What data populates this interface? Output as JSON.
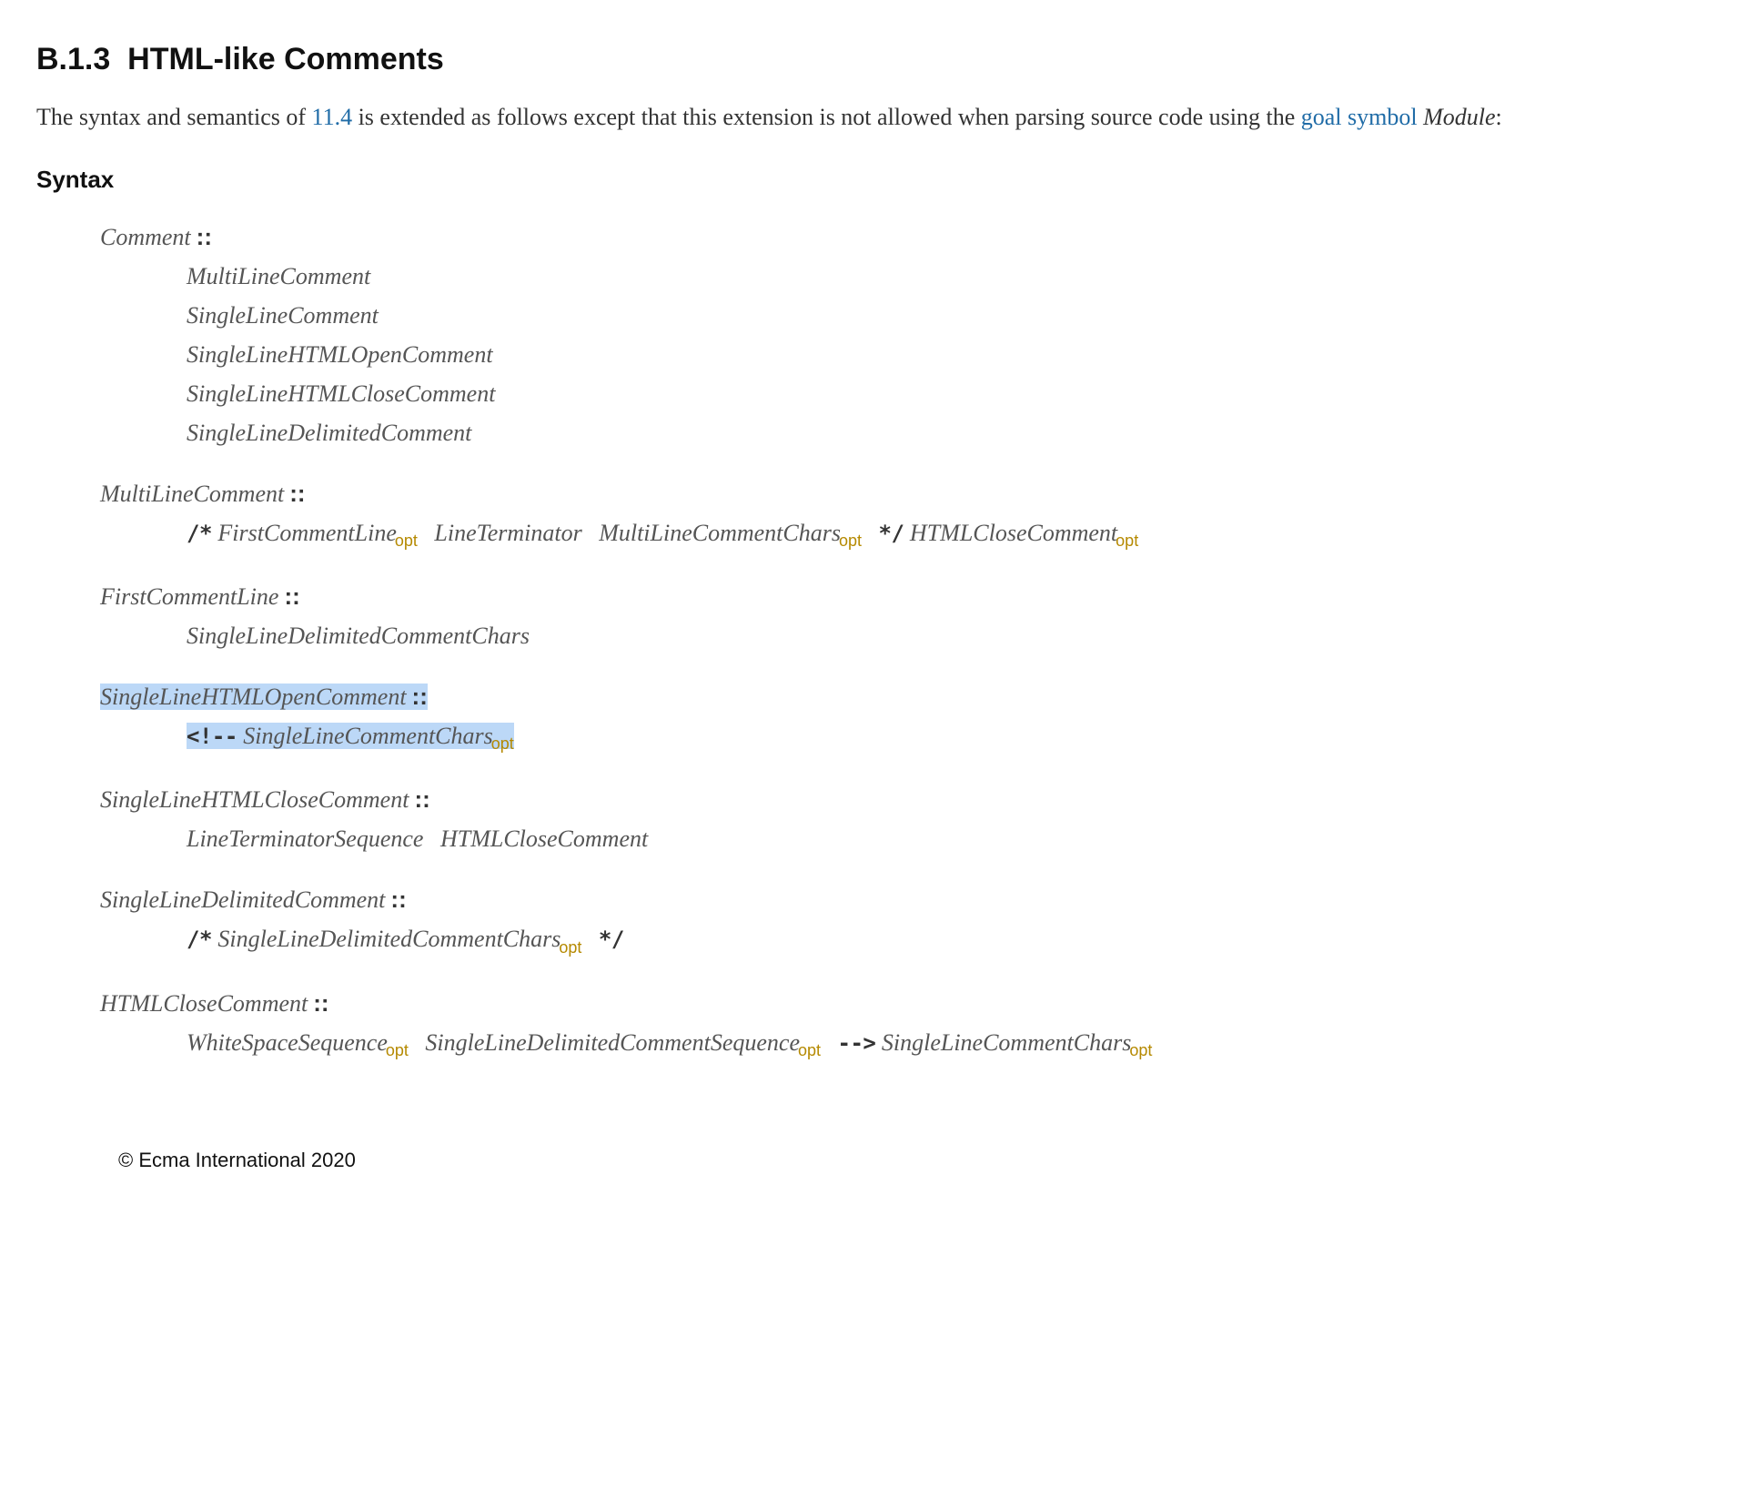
{
  "heading": {
    "number": "B.1.3",
    "title": "HTML-like Comments"
  },
  "intro": {
    "t1": "The syntax and semantics of ",
    "link1": "11.4",
    "t2": " is extended as follows except that this extension is not allowed when parsing source code using the ",
    "link2": "goal symbol",
    "t3": " ",
    "module": "Module",
    "t4": ":"
  },
  "syntaxLabel": "Syntax",
  "sep": "::",
  "opt": "opt",
  "p1": {
    "lhs": "Comment",
    "r1": "MultiLineComment",
    "r2": "SingleLineComment",
    "r3": "SingleLineHTMLOpenComment",
    "r4": "SingleLineHTMLCloseComment",
    "r5": "SingleLineDelimitedComment"
  },
  "p2": {
    "lhs": "MultiLineComment",
    "t_open": "/*",
    "n1": "FirstCommentLine",
    "n2": "LineTerminator",
    "n3": "MultiLineCommentChars",
    "t_close": "*/",
    "n4": "HTMLCloseComment"
  },
  "p3": {
    "lhs": "FirstCommentLine",
    "r1": "SingleLineDelimitedCommentChars"
  },
  "p4": {
    "lhs": "SingleLineHTMLOpenComment",
    "t1": "<!--",
    "n1": "SingleLineCommentChars"
  },
  "p5": {
    "lhs": "SingleLineHTMLCloseComment",
    "n1": "LineTerminatorSequence",
    "n2": "HTMLCloseComment"
  },
  "p6": {
    "lhs": "SingleLineDelimitedComment",
    "t_open": "/*",
    "n1": "SingleLineDelimitedCommentChars",
    "t_close": "*/"
  },
  "p7": {
    "lhs": "HTMLCloseComment",
    "n1": "WhiteSpaceSequence",
    "n2": "SingleLineDelimitedCommentSequence",
    "t1": "-->",
    "n3": "SingleLineCommentChars"
  },
  "footer": "© Ecma International 2020"
}
